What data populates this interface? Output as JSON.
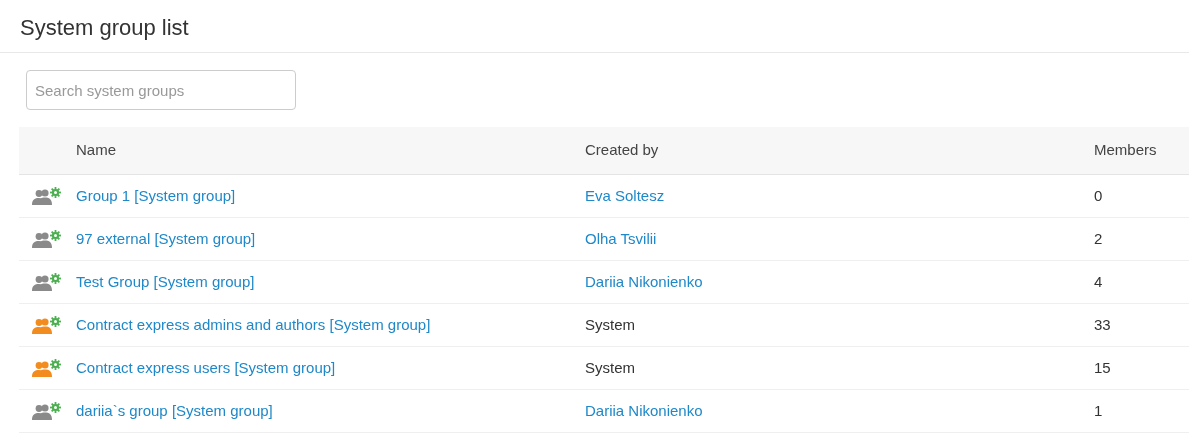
{
  "page_title": "System group list",
  "search": {
    "placeholder": "Search system groups"
  },
  "table": {
    "columns": [
      "Name",
      "Created by",
      "Members"
    ],
    "rows": [
      {
        "name": "Group 1 [System group]",
        "color": "#8a8a8a",
        "creator": {
          "text": "Eva Soltesz",
          "kind": "link"
        },
        "members": "0"
      },
      {
        "name": "97 external [System group]",
        "color": "#8a8a8a",
        "creator": {
          "text": "Olha Tsvilii",
          "kind": "link"
        },
        "members": "2"
      },
      {
        "name": "Test Group [System group]",
        "color": "#8a8a8a",
        "creator": {
          "text": "Dariia Nikonienko",
          "kind": "link"
        },
        "members": "4"
      },
      {
        "name": "Contract express admins and authors [System group]",
        "color": "#f28c1e",
        "creator": {
          "text": "System",
          "kind": "text"
        },
        "members": "33"
      },
      {
        "name": "Contract express users [System group]",
        "color": "#f28c1e",
        "creator": {
          "text": "System",
          "kind": "text"
        },
        "members": "15"
      },
      {
        "name": "dariia`s group [System group]",
        "color": "#8a8a8a",
        "creator": {
          "text": "Dariia Nikonienko",
          "kind": "link"
        },
        "members": "1"
      }
    ]
  }
}
